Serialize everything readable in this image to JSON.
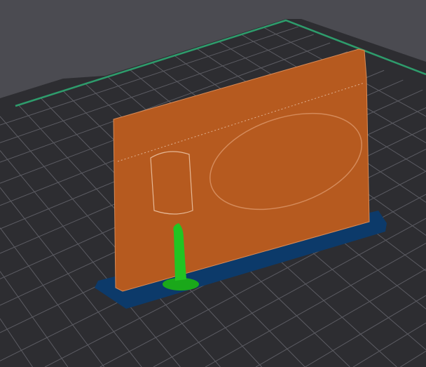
{
  "viewport": {
    "mode": "3d-preview",
    "colors": {
      "background": "#4b4b51",
      "bed": "#2d2d31",
      "grid": "#5c5c63",
      "bed_edge": "#2e9c6c",
      "model": "#b65a1f",
      "brim": "#0c3a6a",
      "support": "#1fc21f"
    },
    "bed_grid_divisions": 14
  }
}
